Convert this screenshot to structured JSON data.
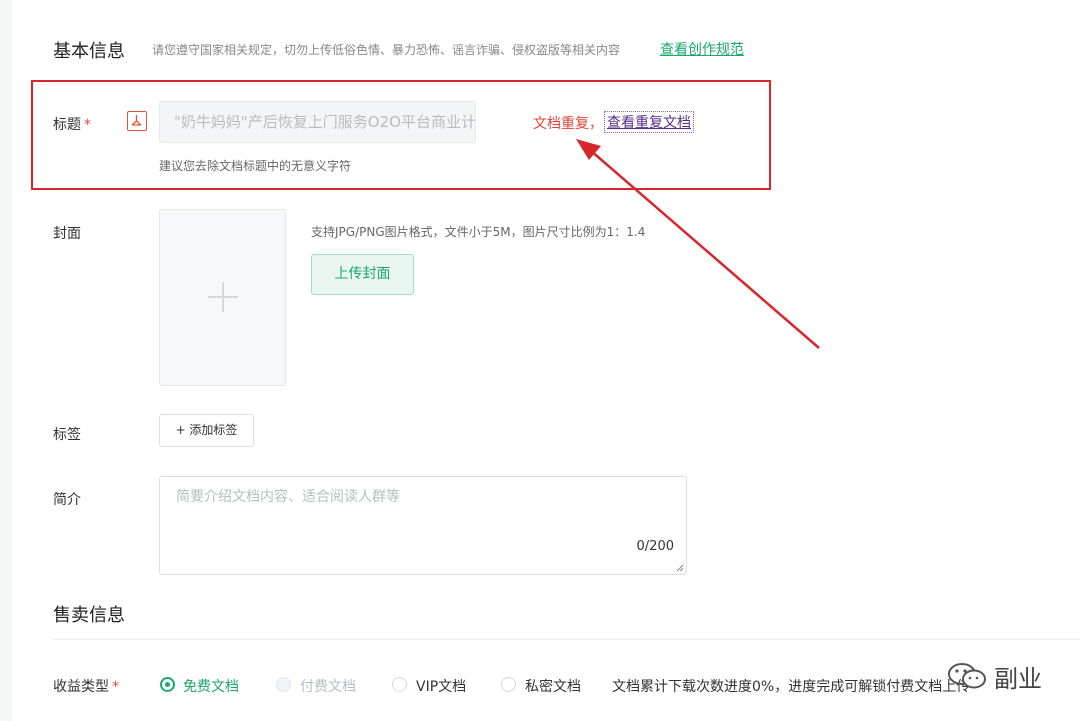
{
  "basic_info": {
    "title": "基本信息",
    "notice": "请您遵守国家相关规定，切勿上传低俗色情、暴力恐怖、谣言诈骗、侵权盗版等相关内容",
    "rules_link": "查看创作规范"
  },
  "title_field": {
    "label": "标题",
    "required_mark": "*",
    "value": "\"奶牛妈妈\"产后恢复上门服务O2O平台商业计",
    "hint": "建议您去除文档标题中的无意义字符",
    "duplicate_text": "文档重复，",
    "duplicate_link": "查看重复文档"
  },
  "cover_field": {
    "label": "封面",
    "hint": "支持JPG/PNG图片格式，文件小于5M，图片尺寸比例为1：1.4",
    "upload_button": "上传封面"
  },
  "tag_field": {
    "label": "标签",
    "add_button": "+ 添加标签"
  },
  "intro_field": {
    "label": "简介",
    "placeholder": "简要介绍文档内容、适合阅读人群等",
    "counter": "0/200"
  },
  "sale_info": {
    "title": "售卖信息",
    "income_label": "收益类型",
    "required_mark": "*",
    "options": [
      {
        "label": "免费文档",
        "selected": true,
        "disabled": false
      },
      {
        "label": "付费文档",
        "selected": false,
        "disabled": true
      },
      {
        "label": "VIP文档",
        "selected": false,
        "disabled": false
      },
      {
        "label": "私密文档",
        "selected": false,
        "disabled": false
      }
    ],
    "note": "文档累计下载次数进度0%，进度完成可解锁付费文档上传"
  },
  "watermark": {
    "text": "副业",
    "icon": "wechat-icon"
  },
  "colors": {
    "accent": "#1aa86b",
    "error": "#e0453a",
    "annotation": "#d9262b"
  }
}
